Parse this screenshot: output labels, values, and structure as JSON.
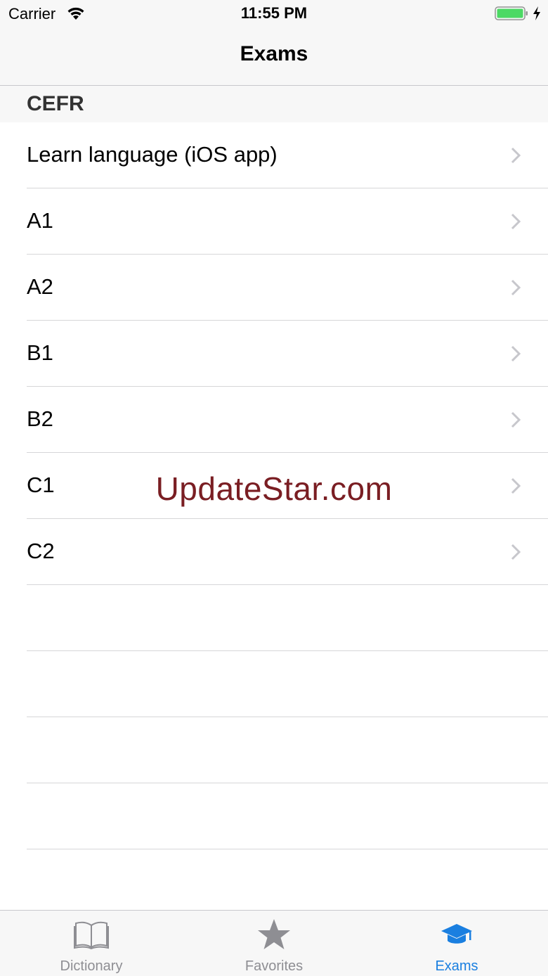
{
  "status_bar": {
    "carrier": "Carrier",
    "time": "11:55 PM",
    "battery_color": "#4cd964"
  },
  "nav": {
    "title": "Exams"
  },
  "section": {
    "title": "CEFR"
  },
  "rows": [
    {
      "label": "Learn language (iOS app)"
    },
    {
      "label": "A1"
    },
    {
      "label": "A2"
    },
    {
      "label": "B1"
    },
    {
      "label": "B2"
    },
    {
      "label": "C1"
    },
    {
      "label": "C2"
    }
  ],
  "watermark": "UpdateStar.com",
  "tabs": [
    {
      "label": "Dictionary",
      "icon": "book-icon",
      "active": false
    },
    {
      "label": "Favorites",
      "icon": "star-icon",
      "active": false
    },
    {
      "label": "Exams",
      "icon": "graduation-cap-icon",
      "active": true
    }
  ],
  "colors": {
    "accent": "#1a7fe0",
    "inactive": "#8e8e93",
    "watermark": "#7a1e23"
  }
}
